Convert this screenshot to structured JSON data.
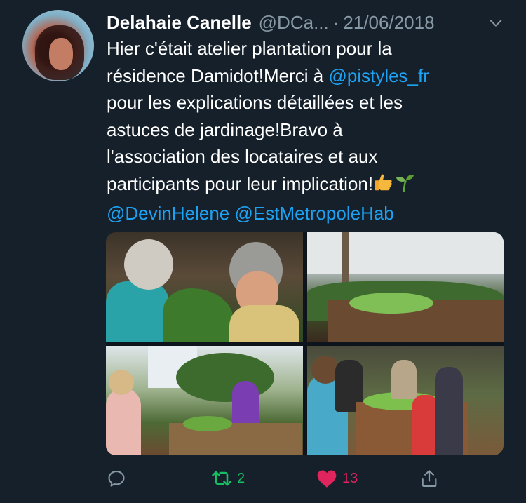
{
  "tweet": {
    "author_name": "Delahaie Canelle",
    "author_handle": "@DCa...",
    "separator": "·",
    "date": "21/06/2018",
    "text_lines": [
      {
        "parts": [
          {
            "t": "Hier c'était atelier plantation pour la",
            "type": "text"
          }
        ]
      },
      {
        "parts": [
          {
            "t": "résidence Damidot!Merci à ",
            "type": "text"
          },
          {
            "t": "@pistyles_fr",
            "type": "mention"
          }
        ]
      },
      {
        "parts": [
          {
            "t": "pour les explications détaillées et les",
            "type": "text"
          }
        ]
      },
      {
        "parts": [
          {
            "t": "astuces de jardinage!Bravo à",
            "type": "text"
          }
        ]
      },
      {
        "parts": [
          {
            "t": "l'association des locataires et aux",
            "type": "text"
          }
        ]
      },
      {
        "parts": [
          {
            "t": "participants pour leur implication!",
            "type": "text"
          }
        ]
      },
      {
        "parts": [
          {
            "t": "@DevinHelene",
            "type": "mention"
          },
          {
            "t": " ",
            "type": "text"
          },
          {
            "t": "@EstMetropoleHab",
            "type": "mention"
          }
        ]
      }
    ],
    "emojis": [
      "thumbs-up-icon",
      "seedling-icon"
    ],
    "photos": [
      "photo-1",
      "photo-2",
      "photo-3",
      "photo-4"
    ],
    "actions": {
      "reply_count": "",
      "retweet_count": "2",
      "like_count": "13",
      "share_count": ""
    }
  },
  "colors": {
    "background": "#15202b",
    "text": "#ffffff",
    "secondary": "#8899a6",
    "mention": "#1da1f2",
    "retweet": "#17bf63",
    "like": "#e0245e"
  }
}
